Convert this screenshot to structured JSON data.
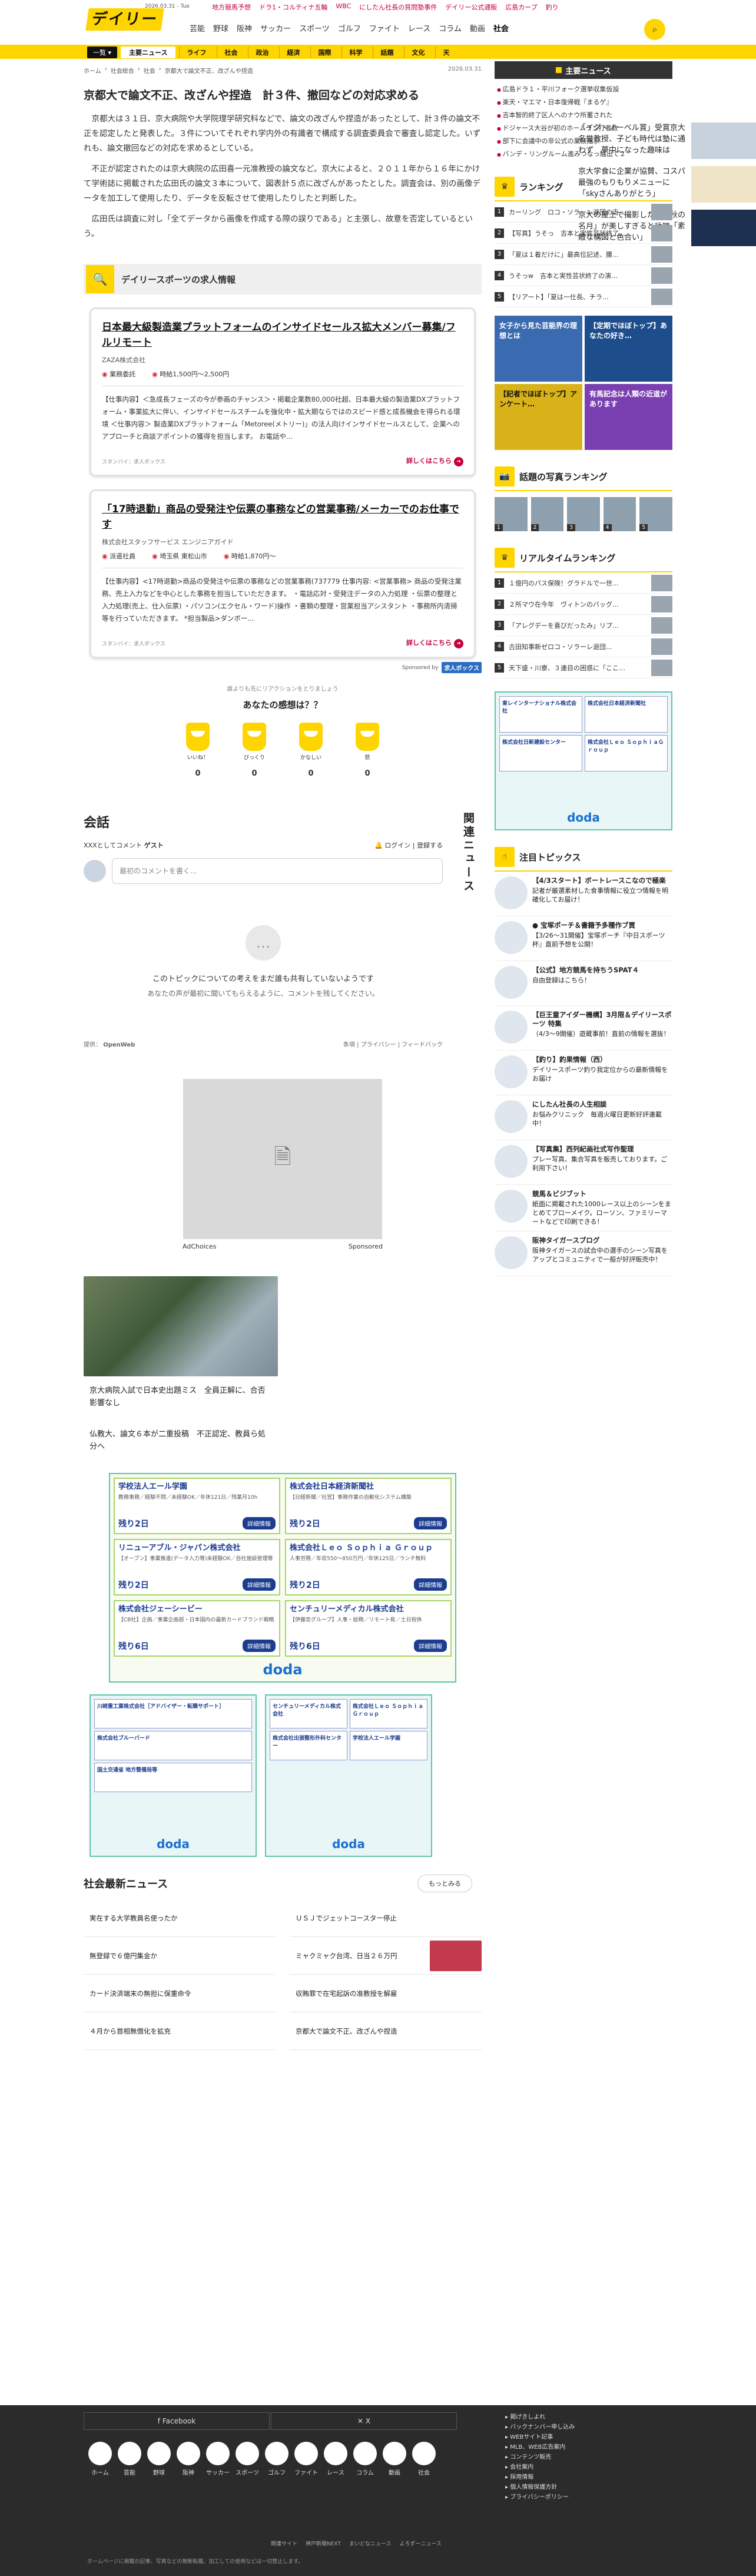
{
  "header": {
    "logo": "デイリー",
    "date": "2026.03.31 - Tue",
    "promos": [
      "地方競馬予想",
      "ドラ1・コルティナ五輪",
      "WBC",
      "にしたん社長の質問塾事件",
      "デイリー公式通販",
      "広島カープ",
      "釣り"
    ],
    "nav": [
      "芸能",
      "野球",
      "阪神",
      "サッカー",
      "スポーツ",
      "ゴルフ",
      "ファイト",
      "レース",
      "コラム",
      "動画",
      "社会"
    ],
    "nav_active": "社会"
  },
  "subnav": {
    "category": "一覧 ▾",
    "items": [
      "主要ニュース",
      "ライフ",
      "社会",
      "政治",
      "経済",
      "国際",
      "科学",
      "話題",
      "文化",
      "天"
    ]
  },
  "breadcrumb": [
    "ホーム",
    "社会総合",
    "社会",
    "京都大で論文不正、改ざんや捏造"
  ],
  "article": {
    "date": "2026.03.31",
    "title": "京都大で論文不正、改ざんや捏造　計３件、撤回などの対応求める",
    "paragraphs": [
      "京都大は３１日、京大病院や大学院理学研究科などで、論文の改ざんや捏造があったとして、計３件の論文不正を認定したと発表した。３件についてそれぞれ学内外の有識者で構成する調査委員会で審査し認定した。いずれも、論文撤回などの対応を求めるとしている。",
      "不正が認定されたのは京大病院の広田喜一元准教授の論文など。京大によると、２０１１年から１６年にかけて学術誌に掲載された広田氏の論文３本について、図表計５点に改ざんがあったとした。調査会は、別の画像データを加工して使用したり、データを反転させて使用したりしたと判断した。",
      "広田氏は調査に対し「全てデータから画像を作成する際の誤りである」と主張し、故意を否定しているという。"
    ]
  },
  "jobs": {
    "title": "デイリースポーツの求人情報",
    "cards": [
      {
        "title": "日本最大級製造業プラットフォームのインサイドセールス拡大メンバー募集/フルリモート",
        "company": "ZAZA株式会社",
        "tags": [
          "業務委託",
          "",
          "時給1,500円〜2,500円"
        ],
        "desc": "【仕事内容】＜急成長フェーズの今が参画のチャンス＞・掲載企業数80,000社超、日本最大級の製造業DXプラットフォーム・事業拡大に伴い、インサイドセールスチームを強化中・拡大期ならではのスピード感と成長機会を得られる環境 ＜仕事内容＞ 製造業DXプラットフォーム「Metoree(メトリー)」の法人向けインサイドセールスとして、企業へのアプローチと商談アポイントの獲得を担当します。 お電話や...",
        "source": "スタンバイ：求人ボックス",
        "more": "詳しくはこちら"
      },
      {
        "title": "「17時退勤」商品の受発注や伝票の事務などの営業事務/メーカーでのお仕事です",
        "company": "株式会社スタッフサービス エンジニアガイド",
        "tags": [
          "派遣社員",
          "埼玉県 東松山市",
          "時給1,870円〜"
        ],
        "desc": "【仕事内容】<17時退勤>商品の受発注や伝票の事務などの営業事務(737779 仕事内容: <営業事務> 商品の受発注業務、売上入力などを中心とした事務を担当していただきます。 ・電話応対・受発注データの入力処理 ・伝票の整理と入力処理(売上、仕入伝票) ・パソコン(エクセル・ワード)操作 ・書類の整理・営業担当アシスタント ・事務所内清掃等を行っていただきます。 *担当製品>ダンボー...",
        "source": "スタンバイ：求人ボックス",
        "more": "詳しくはこちら"
      }
    ],
    "sponsored": "Sponsored by",
    "badge": "求人ボックス"
  },
  "reactions": {
    "prompt": "誰よりも先にリアクションをとりましょう",
    "question": "あなたの感想は？？",
    "items": [
      {
        "label": "いいね！",
        "count": "0"
      },
      {
        "label": "びっくり",
        "count": "0"
      },
      {
        "label": "かなしい",
        "count": "0"
      },
      {
        "label": "怒",
        "count": "0"
      }
    ]
  },
  "comments": {
    "title": "会話",
    "related_vertical": "関連ニュース",
    "as_label": "XXXとしてコメント",
    "user": "ゲスト",
    "login": "ログイン",
    "register": "登録する",
    "placeholder": "最初のコメントを書く...",
    "empty_title": "このトピックについての考えをまだ誰も共有していないようです",
    "empty_sub": "あなたの声が最初に聞いてもらえるように、コメントを残してください。",
    "powered": "提供：",
    "openweb": "OpenWeb",
    "links": [
      "条項",
      "プライバシー",
      "フィードバック"
    ]
  },
  "ad": {
    "adchoices": "AdChoices",
    "sponsored": "Sponsored"
  },
  "related": {
    "main1": "京大病院入試で日本史出題ミス　全員正解に、合否影響なし",
    "main2": "仏教大、論文６本が二重投稿　不正認定、教員ら処分へ",
    "items": [
      "「イグ・ノーベル賞」受賞京大名誉教授、子ども時代は塾に通わず　夢中になった趣味は",
      "京大学食に企業が協賛、コスパ最強のもりもりメニューに「skyさんありがとう」",
      "京大の屋上で撮影した「中秋の名月」が美しすぎると話題「素敵な構図と色合い」"
    ]
  },
  "doda": {
    "cards": [
      {
        "name": "学校法人エール学園",
        "desc": "教務事務／経験不問／未経験OK／年休121日／残業月10h",
        "left": "残り2日",
        "btn": "詳細情報"
      },
      {
        "name": "株式会社日本経済新聞社",
        "desc": "【日経新聞／社営】事務作業の自動化システム構築",
        "left": "残り2日",
        "btn": "詳細情報"
      },
      {
        "name": "リニューアブル・ジャパン株式会社",
        "desc": "【オープン】事業推進(データ入力等)未経験OK／自社施設管理等",
        "left": "残り2日",
        "btn": "詳細情報"
      },
      {
        "name": "株式会社Ｌｅｏ Ｓｏｐｈｉａ Ｇｒｏｕｐ",
        "desc": "人事労務／年収550〜850万円／年休125日／ランチ無料",
        "left": "残り2日",
        "btn": "詳細情報"
      },
      {
        "name": "株式会社ジェーシービー",
        "desc": "【CB社】企画／事業企画部・日本国内の最新カードブランド戦略",
        "left": "残り6日",
        "btn": "詳細情報"
      },
      {
        "name": "センチュリーメディカル株式会社",
        "desc": "【伊藤忠グループ】人事・総務／リモート有／土日祝休",
        "left": "残り6日",
        "btn": "詳細情報"
      }
    ],
    "logo": "doda"
  },
  "doda_small": {
    "left": [
      "川崎重工業株式会社［アドバイザー・転職サポート］",
      "株式会社ブルーバード",
      "国土交通省 地方整備局等"
    ],
    "right": [
      "センチュリーメディカル株式会社",
      "株式会社Ｌｅｏ ＳｏｐｈｉａＧｒｏｕｐ",
      "株式会社出張整形外科センター",
      "学校法人エール学園"
    ]
  },
  "latest": {
    "title": "社会最新ニュース",
    "more": "もっとみる",
    "items": [
      "実在する大学教員名使ったか",
      "ＵＳＪでジェットコースター停止",
      "無登録で６億円集金か",
      "ミャクミャク台湾、日当２６万円",
      "カード決済端末の無担に保重命令",
      "収賄罪で在宅起訴の准教授を解雇",
      "４月から首相無償化を拡充",
      "京都大で論文不正、改ざんや捏造"
    ]
  },
  "sidebar": {
    "news_title": "主要ニュース",
    "news": [
      "広島ドラ１・平川フォーク選挙収集仮設",
      "楽天・マエマ・日本復帰戦『まるゲ』",
      "吉本智的終了区人へのナウ所蓄された",
      "ドジャース大谷が初のホームラン打者数",
      "部下に会議中の非公式の業務指示",
      "バンデ・リングルーム進みつなっ騒出て２"
    ],
    "rank_title": "ランキング",
    "rank": [
      "カーリング　ロコ・ソラーレ退団の吉…",
      "【写真】うそっ　吉本と実性芸状終了…",
      "「夏は１着だけに」最高位記述、腰…",
      "うそっw　吉本と実性芸状終了の演…",
      "【リアート】「夏は一仕長、チラ…"
    ],
    "promos": [
      "女子から見た芸能界の理想とは",
      "【定期でほぼトップ】あなたの好き…",
      "【記者でほぼトップ】アンケート…",
      "有馬記念は人類の近道があります"
    ],
    "photo_title": "話題の写真ランキング",
    "photo_ranks": [
      "1",
      "2",
      "3",
      "4",
      "5"
    ],
    "realtime_title": "リアルタイムランキング",
    "realtime": [
      "１億円のパス保険！グラドルで一世…",
      "２所マウ在今年　ヴィトンのバッグ…",
      "「アレグデーを喜びだったみ」リプ…",
      "古田知事新ゼロコ・ソラーレ退団…",
      "天下盛・川寮、３連目の困惑に「ここ…"
    ],
    "doda": [
      "東レインターナショナル株式会社",
      "株式会社日本経済新聞社",
      "株式会社日新建設センター",
      "株式会社Ｌｅｏ ＳｏｐｈｉａＧｒｏｕｐ"
    ],
    "doda_logo": "doda",
    "topics_title": "注目トピックス",
    "topics": [
      {
        "t": "【4/3スタート】ボートレースこなので極楽",
        "s": "記者が厳選素材した食事情報に役立つ情報を明確化してお届け！"
      },
      {
        "t": "● 宝塚ポーチ＆書籍予多種作ブ買",
        "s": "【3/26〜31開催】宝塚ポーチ『中日スポーツ杯』直前予想を公開！"
      },
      {
        "t": "【公式】地方競馬を持ちうSPAT４",
        "s": "自由登録はこちら！"
      },
      {
        "t": "【巨王童アイダー機構】3月限＆デイリースポーツ 特集",
        "s": "（4/3〜9開催）遊蔵事前！直前の情報を選抜！"
      },
      {
        "t": "【釣り】釣果情報（西）",
        "s": "デイリースポーツ釣り我定位からの最新情報をお届け"
      },
      {
        "t": "にしたん社長の人生相談",
        "s": "お悩みクリニック　毎週火曜日更新好評連載中！"
      },
      {
        "t": "【写真集】西列紀画社式写作聖理",
        "s": "プレー写真、集合写真を販売しております。ご利用下さい！"
      },
      {
        "t": "競馬＆ビジブット",
        "s": "紙面に掲載された1000レース以上のシーンをまとめてブローメイク。ローソン、ファミリーマートなどで印刷できる！"
      },
      {
        "t": "阪神タイガースブログ",
        "s": "阪神タイガースの試合中の選手のシーン写真をアップとコミュニティで一般が好評販売中！"
      }
    ]
  },
  "footer": {
    "social": [
      "Facebook",
      "X"
    ],
    "cats": [
      "ホーム",
      "芸能",
      "野球",
      "阪神",
      "サッカー",
      "スポーツ",
      "ゴルフ",
      "ファイト",
      "レース",
      "コラム",
      "動画",
      "社会"
    ],
    "links": [
      "掲げきしよれ",
      "バックナンバー申し込み",
      "WEBサイト記事",
      "MLB、WEB広告案内",
      "コンテンツ販売",
      "会社案内",
      "採用情報",
      "個人情報保護方針",
      "ブライバシーポリシー"
    ],
    "mid": [
      "関連サイト",
      "神戸新聞NEXT",
      "まいどなニュース",
      "よろずーニュース"
    ],
    "copy": "ホームページに掲載の記事、写真などの無断転載、加工しての使用などは一切禁止します。"
  }
}
